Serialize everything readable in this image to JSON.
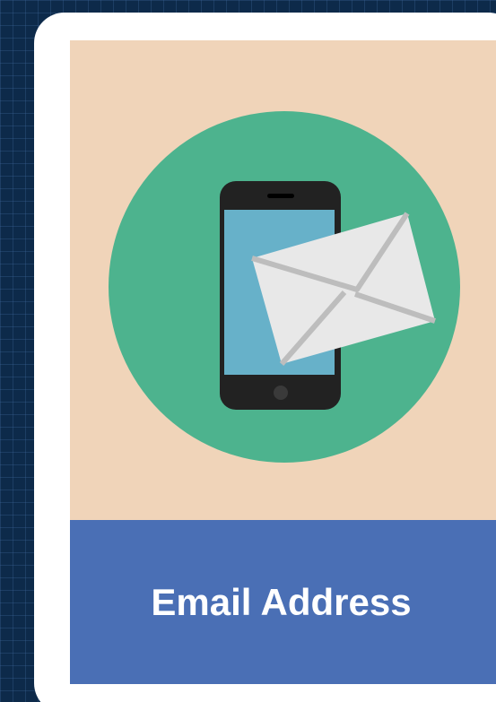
{
  "card": {
    "title": "Email Address",
    "illustration": {
      "icons": [
        "smartphone-icon",
        "envelope-icon"
      ],
      "colors": {
        "panel_background": "#f0d4b9",
        "circle": "#4db38e",
        "phone_body": "#222222",
        "phone_screen": "#67b1c9",
        "envelope": "#e8e8e8",
        "envelope_lines": "#bdbdbd"
      }
    },
    "colors": {
      "page_background": "#0d2a4a",
      "card_background": "#ffffff",
      "label_background": "#4a6fb5",
      "label_text": "#ffffff"
    }
  }
}
